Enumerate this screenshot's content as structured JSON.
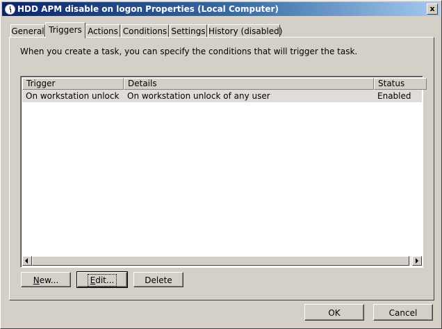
{
  "window": {
    "title": "HDD APM disable on logon Properties (Local Computer)",
    "close_label": "x"
  },
  "tabs": [
    {
      "label": "General"
    },
    {
      "label": "Triggers",
      "active": true
    },
    {
      "label": "Actions"
    },
    {
      "label": "Conditions"
    },
    {
      "label": "Settings"
    },
    {
      "label": "History (disabled)"
    }
  ],
  "triggers_tab": {
    "description": "When you create a task, you can specify the conditions that will trigger the task.",
    "columns": [
      "Trigger",
      "Details",
      "Status"
    ],
    "rows": [
      {
        "trigger": "On workstation unlock",
        "details": "On workstation unlock of any user",
        "status": "Enabled",
        "selected": true
      }
    ],
    "buttons": {
      "new_pre": "N",
      "new_rest": "ew...",
      "edit_pre": "E",
      "edit_rest": "dit...",
      "delete_label": "Delete"
    }
  },
  "dialog_buttons": {
    "ok_label": "OK",
    "cancel_label": "Cancel"
  }
}
